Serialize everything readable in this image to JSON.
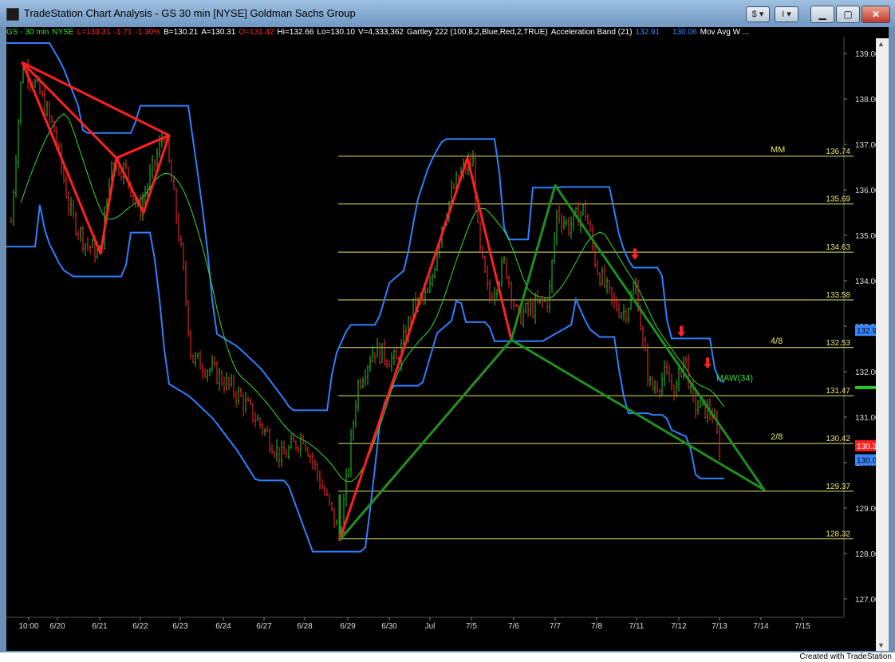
{
  "window": {
    "title": "TradeStation Chart Analysis - GS 30 min [NYSE] Goldman Sachs Group",
    "symbol_button": "$",
    "info_button": "I"
  },
  "infobar": {
    "symbol": "GS - 30 min",
    "exchange": "NYSE",
    "last": "L=130.31",
    "change": "-1.71",
    "change_pct": "-1.30%",
    "bid": "B=130.21",
    "ask": "A=130.31",
    "open": "O=131.42",
    "high": "Hi=132.66",
    "low": "Lo=130.10",
    "volume": "V=4,333,362",
    "gartley": "Gartley 222 (100,8,2,Blue,Red,2,TRUE)",
    "accel_band": "Acceleration Band (21)",
    "accel_value": "132.91",
    "mov_value": "130.06",
    "mov_avg": "Mov Avg W ..."
  },
  "footer": {
    "created_with": "Created with TradeStation"
  },
  "chart_data": {
    "type": "candlestick",
    "symbol": "GS",
    "interval": "30 min",
    "ylim": [
      126.7,
      139.3
    ],
    "y_ticks": [
      "139.00",
      "138.00",
      "137.00",
      "136.00",
      "135.00",
      "134.00",
      "133.00",
      "132.00",
      "131.00",
      "130.00",
      "129.00",
      "128.00",
      "127.00"
    ],
    "x_ticks": [
      "10:00",
      "6/20",
      "6/21",
      "6/22",
      "6/23",
      "6/24",
      "6/27",
      "6/28",
      "6/29",
      "6/30",
      "Jul",
      "7/5",
      "7/6",
      "7/7",
      "7/8",
      "7/11",
      "7/12",
      "7/13",
      "7/14",
      "7/15"
    ],
    "murrey_levels": [
      {
        "value": 136.74,
        "label": "136.74",
        "tag": "MM"
      },
      {
        "value": 135.69,
        "label": "135.69",
        "tag": ""
      },
      {
        "value": 134.63,
        "label": "134.63",
        "tag": ""
      },
      {
        "value": 133.58,
        "label": "133.58",
        "tag": ""
      },
      {
        "value": 132.53,
        "label": "132.53",
        "tag": "4/8"
      },
      {
        "value": 131.47,
        "label": "131.47",
        "tag": ""
      },
      {
        "value": 130.42,
        "label": "130.42",
        "tag": "2/8"
      },
      {
        "value": 129.37,
        "label": "129.37",
        "tag": ""
      },
      {
        "value": 128.32,
        "label": "128.32",
        "tag": ""
      }
    ],
    "price_tags": [
      {
        "label": "132.91",
        "value": 132.91,
        "color": "#3a86ff"
      },
      {
        "label": "130.37",
        "value": 130.37,
        "color": "#ff2020"
      },
      {
        "label": "130.06",
        "value": 130.06,
        "color": "#3a86ff"
      }
    ],
    "maw_label": "MAW(34)",
    "colors": {
      "up": "#29c729",
      "down": "#ff2a2a",
      "band": "#2f7fff",
      "ma": "#33dd33",
      "level": "#e6e673",
      "pattern_red": "#ff2020",
      "pattern_green": "#1f8f1f",
      "arrow": "#ff2020"
    }
  }
}
